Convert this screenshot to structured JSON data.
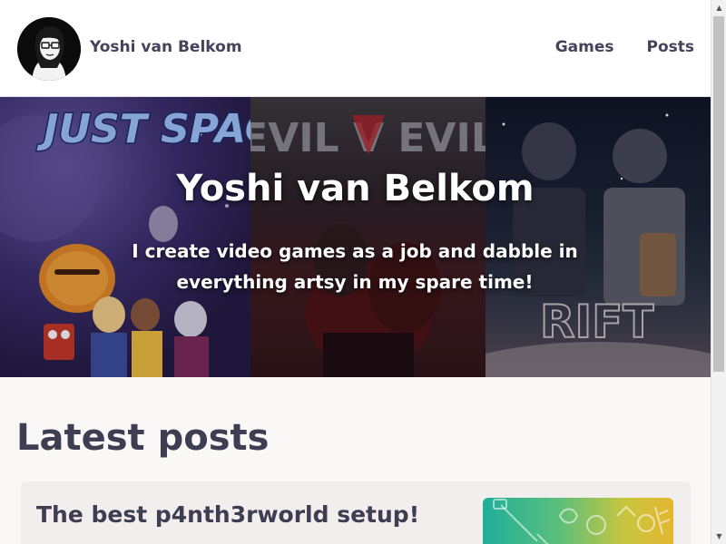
{
  "header": {
    "site_name": "Yoshi van Belkom",
    "nav": [
      {
        "label": "Games"
      },
      {
        "label": "Posts"
      }
    ]
  },
  "hero": {
    "title": "Yoshi van Belkom",
    "subtitle": "I create video games as a job and dabble in everything artsy in my spare time!",
    "banner_games": [
      "JUST SPACE",
      "EVIL V EVIL",
      "RIFT"
    ]
  },
  "main": {
    "section_title": "Latest posts",
    "posts": [
      {
        "title": "The best p4nth3rworld setup!"
      }
    ]
  },
  "colors": {
    "text": "#3e3d52",
    "page_bg": "#faf8f7",
    "card_bg": "#f1eeed"
  },
  "icons": {
    "scroll_up": "triangle-up-icon",
    "scroll_down": "triangle-down-icon"
  }
}
